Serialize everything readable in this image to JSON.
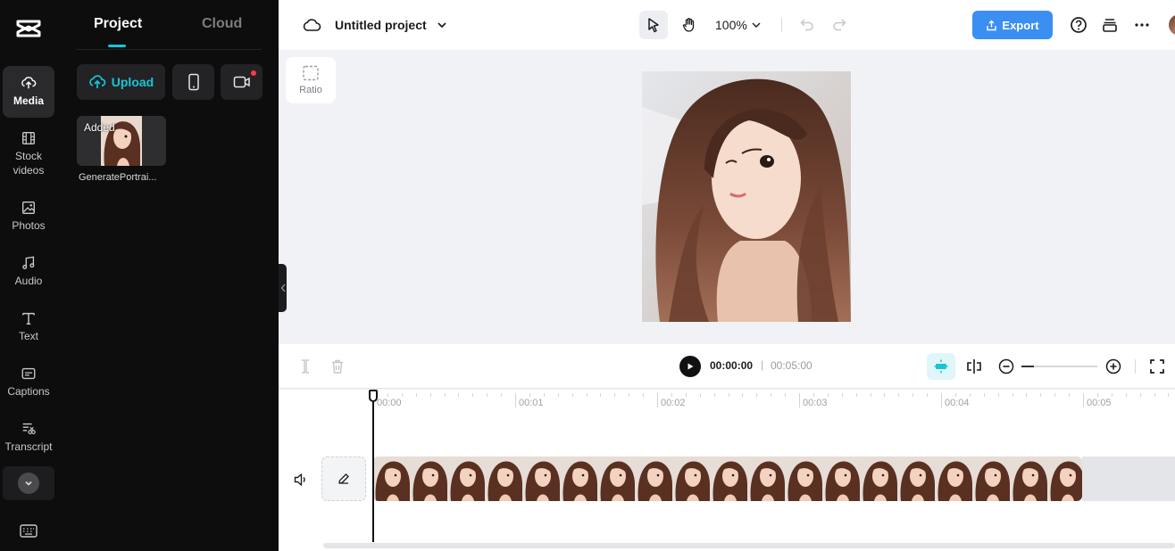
{
  "app": {
    "brand_icon": "capcut-logo-icon"
  },
  "sidebar": {
    "items": [
      {
        "label": "Media",
        "icon": "cloud-upload-icon",
        "active": true
      },
      {
        "label": "Stock videos",
        "icon": "film-icon"
      },
      {
        "label": "Photos",
        "icon": "image-icon"
      },
      {
        "label": "Audio",
        "icon": "music-note-icon"
      },
      {
        "label": "Text",
        "icon": "text-t-icon"
      },
      {
        "label": "Captions",
        "icon": "captions-icon"
      },
      {
        "label": "Transcript",
        "icon": "transcript-icon"
      }
    ],
    "more_icon": "chevron-down-icon",
    "shortcuts_icon": "keyboard-icon"
  },
  "panel": {
    "tabs": [
      {
        "label": "Project",
        "active": true
      },
      {
        "label": "Cloud"
      }
    ],
    "upload_label": "Upload",
    "phone_icon": "phone-icon",
    "record_icon": "video-camera-icon",
    "media": [
      {
        "badge": "Added",
        "name": "GeneratePortrai..."
      }
    ]
  },
  "topbar": {
    "project_title": "Untitled project",
    "zoom": "100%",
    "export_label": "Export",
    "accent": "#3b8ef2"
  },
  "canvas": {
    "ratio_label": "Ratio"
  },
  "player": {
    "current_time": "00:00:00",
    "separator": "|",
    "total_time": "00:05:00"
  },
  "timeline": {
    "ruler": [
      "00:00",
      "00:01",
      "00:02",
      "00:03",
      "00:04",
      "00:05"
    ],
    "clip_frames": 19,
    "playhead_fraction": 0.0,
    "zoom_fraction": 0.16
  },
  "colors": {
    "accent_teal": "#16c6d6",
    "export_blue": "#3b8ef2",
    "notification": "#ff3b48"
  }
}
